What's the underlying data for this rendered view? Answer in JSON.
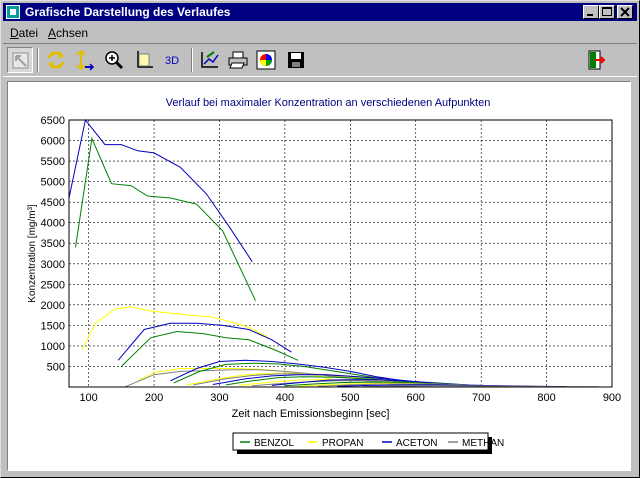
{
  "window": {
    "title": "Grafische Darstellung des Verlaufes"
  },
  "menu": [
    {
      "label": "Datei",
      "accel": "D",
      "rest": "atei"
    },
    {
      "label": "Achsen",
      "accel": "A",
      "rest": "chsen"
    }
  ],
  "toolbar": {
    "three_d_label": "3D",
    "icons": [
      "arrow-select-icon",
      "refresh-icon",
      "axis-scale-icon",
      "zoom-icon",
      "frame-icon",
      "3d-icon",
      "chart-edit-icon",
      "print-icon",
      "color-palette-icon",
      "save-icon",
      "exit-icon"
    ]
  },
  "colors": {
    "benzol": "#008000",
    "propan": "#ffff00",
    "aceton": "#0000c0",
    "methan": "#808080",
    "title": "#000080"
  },
  "chart_data": {
    "type": "line",
    "title": "Verlauf bei maximaler Konzentration an verschiedenen Aufpunkten",
    "xlabel": "Zeit nach Emissionsbeginn [sec]",
    "ylabel": "Konzentration [mg/m³]",
    "xlim": [
      70,
      900
    ],
    "ylim": [
      0,
      6500
    ],
    "xticks": [
      "100",
      "200",
      "300",
      "400",
      "500",
      "600",
      "700",
      "800",
      "900"
    ],
    "yticks": [
      "500",
      "1000",
      "1500",
      "2000",
      "2500",
      "3000",
      "3500",
      "4000",
      "4500",
      "5000",
      "5500",
      "6000",
      "6500"
    ],
    "grid": true,
    "legend_position": "bottom-center",
    "legend": [
      "BENZOL",
      "PROPAN",
      "ACETON",
      "METHAN"
    ],
    "series": [
      {
        "name": "ACETON",
        "color": "#0000c0",
        "points": [
          [
            70,
            4600
          ],
          [
            95,
            6500
          ],
          [
            125,
            5900
          ],
          [
            150,
            5900
          ],
          [
            175,
            5750
          ],
          [
            200,
            5700
          ],
          [
            240,
            5350
          ],
          [
            280,
            4700
          ],
          [
            315,
            3900
          ],
          [
            350,
            3050
          ]
        ]
      },
      {
        "name": "BENZOL",
        "color": "#008000",
        "points": [
          [
            80,
            3400
          ],
          [
            105,
            6050
          ],
          [
            135,
            4950
          ],
          [
            165,
            4900
          ],
          [
            190,
            4650
          ],
          [
            225,
            4600
          ],
          [
            265,
            4450
          ],
          [
            305,
            3800
          ],
          [
            355,
            2100
          ]
        ]
      },
      {
        "name": "PROPAN",
        "color": "#ffff00",
        "points": [
          [
            90,
            900
          ],
          [
            110,
            1550
          ],
          [
            140,
            1900
          ],
          [
            165,
            1950
          ],
          [
            195,
            1850
          ],
          [
            225,
            1800
          ],
          [
            255,
            1750
          ],
          [
            290,
            1700
          ],
          [
            315,
            1600
          ],
          [
            345,
            1450
          ],
          [
            375,
            1200
          ]
        ]
      },
      {
        "name": "ACETON",
        "color": "#0000c0",
        "points": [
          [
            145,
            650
          ],
          [
            185,
            1400
          ],
          [
            225,
            1550
          ],
          [
            265,
            1550
          ],
          [
            305,
            1500
          ],
          [
            345,
            1400
          ],
          [
            380,
            1150
          ],
          [
            410,
            850
          ]
        ]
      },
      {
        "name": "BENZOL",
        "color": "#008000",
        "points": [
          [
            150,
            500
          ],
          [
            195,
            1200
          ],
          [
            235,
            1350
          ],
          [
            275,
            1300
          ],
          [
            310,
            1200
          ],
          [
            345,
            1150
          ],
          [
            385,
            900
          ],
          [
            420,
            650
          ]
        ]
      },
      {
        "name": "PROPAN",
        "color": "#ffff00",
        "points": [
          [
            175,
            150
          ],
          [
            200,
            350
          ],
          [
            240,
            450
          ],
          [
            280,
            450
          ],
          [
            320,
            450
          ],
          [
            360,
            430
          ],
          [
            400,
            380
          ],
          [
            440,
            300
          ],
          [
            470,
            200
          ]
        ]
      },
      {
        "name": "METHAN",
        "color": "#808080",
        "points": [
          [
            155,
            0
          ],
          [
            200,
            300
          ],
          [
            240,
            380
          ],
          [
            280,
            400
          ],
          [
            320,
            420
          ],
          [
            360,
            420
          ],
          [
            400,
            380
          ],
          [
            440,
            320
          ],
          [
            480,
            250
          ],
          [
            520,
            200
          ],
          [
            560,
            150
          ],
          [
            600,
            100
          ]
        ]
      },
      {
        "name": "ACETON",
        "color": "#0000c0",
        "points": [
          [
            225,
            150
          ],
          [
            265,
            450
          ],
          [
            300,
            620
          ],
          [
            340,
            650
          ],
          [
            380,
            620
          ],
          [
            420,
            560
          ],
          [
            460,
            480
          ],
          [
            500,
            380
          ],
          [
            540,
            250
          ],
          [
            580,
            150
          ]
        ]
      },
      {
        "name": "BENZOL",
        "color": "#008000",
        "points": [
          [
            230,
            100
          ],
          [
            270,
            380
          ],
          [
            310,
            550
          ],
          [
            350,
            580
          ],
          [
            390,
            560
          ],
          [
            430,
            500
          ],
          [
            470,
            400
          ],
          [
            510,
            300
          ],
          [
            550,
            200
          ]
        ]
      },
      {
        "name": "PROPAN",
        "color": "#ffff00",
        "points": [
          [
            250,
            50
          ],
          [
            300,
            200
          ],
          [
            340,
            300
          ],
          [
            380,
            330
          ],
          [
            420,
            330
          ],
          [
            460,
            300
          ],
          [
            500,
            250
          ],
          [
            540,
            180
          ],
          [
            580,
            100
          ]
        ]
      },
      {
        "name": "METHAN",
        "color": "#808080",
        "points": [
          [
            260,
            50
          ],
          [
            310,
            200
          ],
          [
            350,
            280
          ],
          [
            390,
            320
          ],
          [
            430,
            320
          ],
          [
            470,
            300
          ],
          [
            510,
            250
          ],
          [
            550,
            180
          ],
          [
            600,
            100
          ]
        ]
      },
      {
        "name": "ACETON",
        "color": "#0000c0",
        "points": [
          [
            290,
            60
          ],
          [
            340,
            200
          ],
          [
            380,
            270
          ],
          [
            420,
            300
          ],
          [
            460,
            300
          ],
          [
            500,
            260
          ],
          [
            540,
            220
          ],
          [
            580,
            160
          ],
          [
            620,
            100
          ]
        ]
      },
      {
        "name": "BENZOL",
        "color": "#008000",
        "points": [
          [
            310,
            50
          ],
          [
            350,
            150
          ],
          [
            390,
            230
          ],
          [
            430,
            250
          ],
          [
            470,
            240
          ],
          [
            510,
            210
          ],
          [
            550,
            170
          ],
          [
            590,
            120
          ],
          [
            630,
            70
          ]
        ]
      },
      {
        "name": "PROPAN",
        "color": "#ffff00",
        "points": [
          [
            330,
            40
          ],
          [
            380,
            120
          ],
          [
            420,
            170
          ],
          [
            460,
            180
          ],
          [
            500,
            170
          ],
          [
            540,
            140
          ],
          [
            580,
            110
          ],
          [
            620,
            70
          ],
          [
            660,
            40
          ]
        ]
      },
      {
        "name": "METHAN",
        "color": "#808080",
        "points": [
          [
            350,
            30
          ],
          [
            400,
            90
          ],
          [
            440,
            130
          ],
          [
            480,
            150
          ],
          [
            520,
            150
          ],
          [
            560,
            130
          ],
          [
            600,
            100
          ],
          [
            640,
            70
          ],
          [
            680,
            40
          ]
        ]
      },
      {
        "name": "ACETON",
        "color": "#0000c0",
        "points": [
          [
            380,
            40
          ],
          [
            430,
            120
          ],
          [
            470,
            170
          ],
          [
            510,
            180
          ],
          [
            550,
            170
          ],
          [
            590,
            140
          ],
          [
            630,
            100
          ],
          [
            670,
            60
          ],
          [
            710,
            30
          ]
        ]
      },
      {
        "name": "BENZOL",
        "color": "#008000",
        "points": [
          [
            400,
            30
          ],
          [
            450,
            80
          ],
          [
            490,
            110
          ],
          [
            530,
            120
          ],
          [
            570,
            110
          ],
          [
            610,
            90
          ],
          [
            650,
            70
          ],
          [
            690,
            40
          ],
          [
            730,
            20
          ]
        ]
      },
      {
        "name": "PROPAN",
        "color": "#ffff00",
        "points": [
          [
            420,
            20
          ],
          [
            470,
            60
          ],
          [
            510,
            80
          ],
          [
            550,
            90
          ],
          [
            590,
            85
          ],
          [
            630,
            70
          ],
          [
            670,
            50
          ],
          [
            710,
            30
          ]
        ]
      },
      {
        "name": "METHAN",
        "color": "#808080",
        "points": [
          [
            450,
            20
          ],
          [
            500,
            50
          ],
          [
            540,
            70
          ],
          [
            580,
            75
          ],
          [
            620,
            70
          ],
          [
            660,
            55
          ],
          [
            700,
            40
          ],
          [
            740,
            25
          ],
          [
            790,
            10
          ]
        ]
      },
      {
        "name": "ACETON",
        "color": "#0000c0",
        "points": [
          [
            480,
            20
          ],
          [
            530,
            40
          ],
          [
            580,
            50
          ],
          [
            630,
            50
          ],
          [
            680,
            40
          ],
          [
            730,
            30
          ],
          [
            780,
            20
          ],
          [
            830,
            10
          ]
        ]
      },
      {
        "name": "METHAN",
        "color": "#808080",
        "points": [
          [
            520,
            10
          ],
          [
            580,
            25
          ],
          [
            640,
            30
          ],
          [
            700,
            25
          ],
          [
            760,
            15
          ],
          [
            820,
            10
          ],
          [
            880,
            5
          ]
        ]
      }
    ]
  }
}
